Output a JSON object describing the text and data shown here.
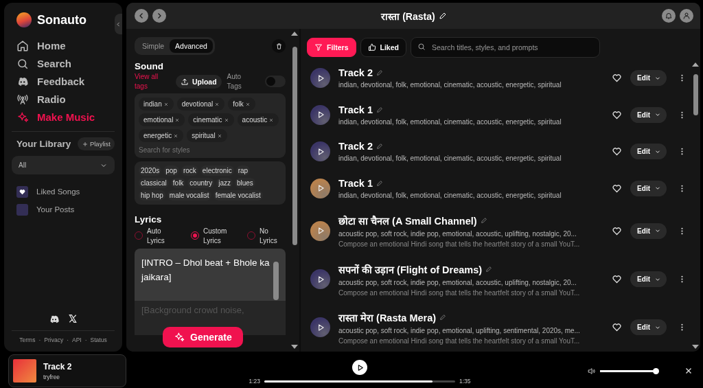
{
  "sidebar": {
    "brand": "Sonauto",
    "nav": [
      {
        "label": "Home",
        "kind": "home",
        "selected": false
      },
      {
        "label": "Search",
        "kind": "search",
        "selected": false
      },
      {
        "label": "Feedback",
        "kind": "discord",
        "selected": false
      },
      {
        "label": "Radio",
        "kind": "radio",
        "selected": false
      },
      {
        "label": "Make Music",
        "kind": "sparkle",
        "selected": true
      }
    ],
    "library_title": "Your Library",
    "playlist_button": "Playlist",
    "library_filter": "All",
    "library_items": [
      {
        "label": "Liked Songs",
        "kind": "liked"
      },
      {
        "label": "Your Posts",
        "kind": "posts"
      }
    ],
    "footer_links": [
      "Terms",
      "Privacy",
      "API",
      "Status"
    ],
    "footer_separator": "·"
  },
  "header": {
    "title": "रास्ता (Rasta)"
  },
  "create": {
    "modes": [
      {
        "label": "Simple",
        "selected": false
      },
      {
        "label": "Advanced",
        "selected": true
      }
    ],
    "sound_title": "Sound",
    "view_all_tags": "View all tags",
    "upload_button": "Upload",
    "auto_tags_label": "Auto Tags",
    "auto_tags_on": false,
    "tags": [
      "indian",
      "devotional",
      "folk",
      "emotional",
      "cinematic",
      "acoustic",
      "energetic",
      "spiritual"
    ],
    "tag_search_placeholder": "Search for styles",
    "suggestions": [
      "2020s",
      "pop",
      "rock",
      "electronic",
      "rap",
      "classical",
      "folk",
      "country",
      "jazz",
      "blues",
      "hip hop",
      "male vocalist",
      "female vocalist"
    ],
    "lyrics_title": "Lyrics",
    "lyrics_modes": [
      {
        "label": "Auto Lyrics",
        "selected": false
      },
      {
        "label": "Custom Lyrics",
        "selected": true
      },
      {
        "label": "No Lyrics",
        "selected": false
      }
    ],
    "lyrics_value": "[INTRO – Dhol beat + Bhole ka jaikara]",
    "lyrics_faded": "[Background crowd noise,",
    "generate_button": "Generate"
  },
  "tracks_panel": {
    "filters": [
      {
        "label": "Filters",
        "kind": "filter",
        "selected": true
      },
      {
        "label": "Liked",
        "kind": "thumb",
        "selected": false
      }
    ],
    "search_placeholder": "Search titles, styles, and prompts",
    "tracks": [
      {
        "title": "Track 2",
        "tags": "indian, devotional, folk, emotional, cinematic, acoustic, energetic, spiritual",
        "color": "#3b3566",
        "liked": false,
        "edit": "Edit"
      },
      {
        "title": "Track 1",
        "tags": "indian, devotional, folk, emotional, cinematic, acoustic, energetic, spiritual",
        "color": "#3b3566",
        "liked": false,
        "edit": "Edit"
      },
      {
        "title": "Track 2",
        "tags": "indian, devotional, folk, emotional, cinematic, acoustic, energetic, spiritual",
        "color": "#3b3566",
        "liked": false,
        "edit": "Edit"
      },
      {
        "title": "Track 1",
        "tags": "indian, devotional, folk, emotional, cinematic, acoustic, energetic, spiritual",
        "color": "#b8824e",
        "liked": false,
        "edit": "Edit"
      },
      {
        "title": "छोटा सा चैनल (A Small Channel)",
        "tags": "acoustic pop, soft rock, indie pop, emotional, acoustic, uplifting, nostalgic, 20...",
        "prompt": "Compose an emotional Hindi song that tells the heartfelt story of a small YouT...",
        "color": "#b8824e",
        "liked": false,
        "edit": "Edit"
      },
      {
        "title": "सपनों की उड़ान (Flight of Dreams)",
        "tags": "acoustic pop, soft rock, indie pop, emotional, acoustic, uplifting, nostalgic, 20...",
        "prompt": "Compose an emotional Hindi song that tells the heartfelt story of a small YouT...",
        "color": "#3b3566",
        "liked": false,
        "edit": "Edit"
      },
      {
        "title": "रास्ता मेरा (Rasta Mera)",
        "tags": "acoustic pop, soft rock, indie pop, emotional, uplifting, sentimental, 2020s, me...",
        "prompt": "Compose an emotional Hindi song that tells the heartfelt story of a small YouT...",
        "color": "#3b3566",
        "liked": false,
        "edit": "Edit"
      }
    ]
  },
  "player": {
    "title": "Track 2",
    "artist": "tryfree",
    "elapsed": "1:23",
    "total": "1:35",
    "level": 0.88,
    "volume": {
      "level": 0.95
    }
  }
}
